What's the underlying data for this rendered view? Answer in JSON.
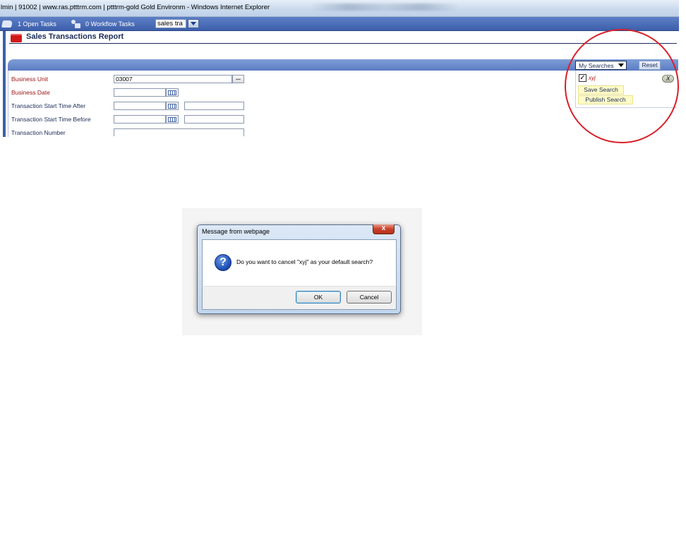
{
  "browser": {
    "title": "lmin | 91002 | www.ras.ptttrm.com | ptttrm-gold Gold Environm - Windows Internet Explorer"
  },
  "toolbar": {
    "open_tasks": "1 Open Tasks",
    "workflow_tasks": "0 Workflow Tasks",
    "search_value": "sales tra"
  },
  "report": {
    "title": "Sales Transactions Report"
  },
  "search_panel": {
    "my_searches_label": "My Searches",
    "reset_label": "Reset",
    "saved_search_name": "xyj",
    "saved_search_checked": true,
    "delete_label": "X",
    "save_search_label": "Save Search",
    "publish_search_label": "Publish Search"
  },
  "form": {
    "fields": [
      {
        "label": "Business Unit",
        "value": "03007",
        "required": true
      },
      {
        "label": "Business Date",
        "value": "",
        "required": true
      },
      {
        "label": "Transaction Start Time After",
        "value": "",
        "required": false
      },
      {
        "label": "Transaction Start Time Before",
        "value": "",
        "required": false
      },
      {
        "label": "Transaction Number",
        "value": "",
        "required": false
      }
    ],
    "lookup_label": "..."
  },
  "dialog": {
    "title": "Message from webpage",
    "close_label": "x",
    "icon": "question-icon",
    "message": "Do you want to cancel \"xyj\" as your default search?",
    "ok_label": "OK",
    "cancel_label": "Cancel"
  },
  "colors": {
    "toolbar_blue": "#3d5fab",
    "required_label": "#a01818",
    "highlight_ring": "#d8202a"
  }
}
